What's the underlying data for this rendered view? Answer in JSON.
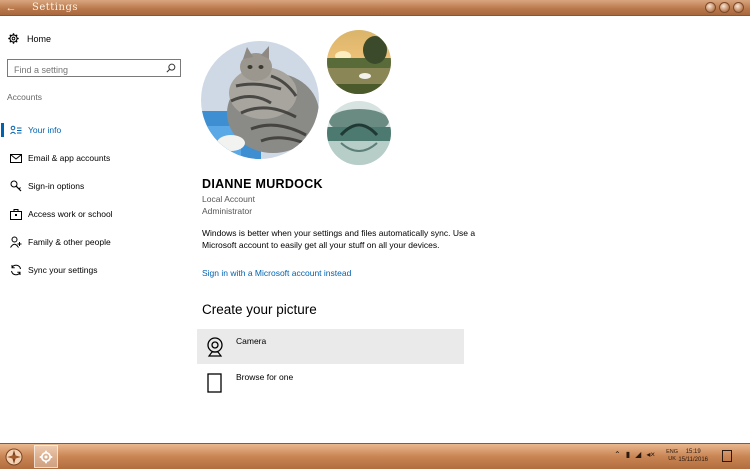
{
  "window": {
    "title": "Settings",
    "back_icon": "back-arrow-icon",
    "controls": [
      "minimize-icon",
      "maximize-icon",
      "close-icon"
    ]
  },
  "sidebar": {
    "home_label": "Home",
    "home_icon": "gear-icon",
    "search_placeholder": "Find a setting",
    "search_icon": "search-icon",
    "section_label": "Accounts",
    "items": [
      {
        "label": "Your info",
        "icon": "person-card-icon",
        "active": true
      },
      {
        "label": "Email & app accounts",
        "icon": "mail-icon",
        "active": false
      },
      {
        "label": "Sign-in options",
        "icon": "key-icon",
        "active": false
      },
      {
        "label": "Access work or school",
        "icon": "briefcase-icon",
        "active": false
      },
      {
        "label": "Family & other people",
        "icon": "person-add-icon",
        "active": false
      },
      {
        "label": "Sync your settings",
        "icon": "sync-icon",
        "active": false
      }
    ]
  },
  "main": {
    "user_name": "DIANNE MURDOCK",
    "account_type": "Local Account",
    "role": "Administrator",
    "info_text": "Windows is better when your settings and files automatically sync. Use a Microsoft account to easily get all your stuff on all your devices.",
    "ms_link": "Sign in with a Microsoft account instead",
    "create_heading": "Create your picture",
    "options": [
      {
        "label": "Camera",
        "icon": "camera-icon"
      },
      {
        "label": "Browse for one",
        "icon": "document-icon"
      }
    ]
  },
  "taskbar": {
    "language_top": "ENG",
    "language_bottom": "UK",
    "time": "15:19",
    "date": "15/11/2016",
    "accent": "#c98554"
  },
  "colors": {
    "accent": "#0063b1",
    "titlebar": "#b8774a"
  }
}
